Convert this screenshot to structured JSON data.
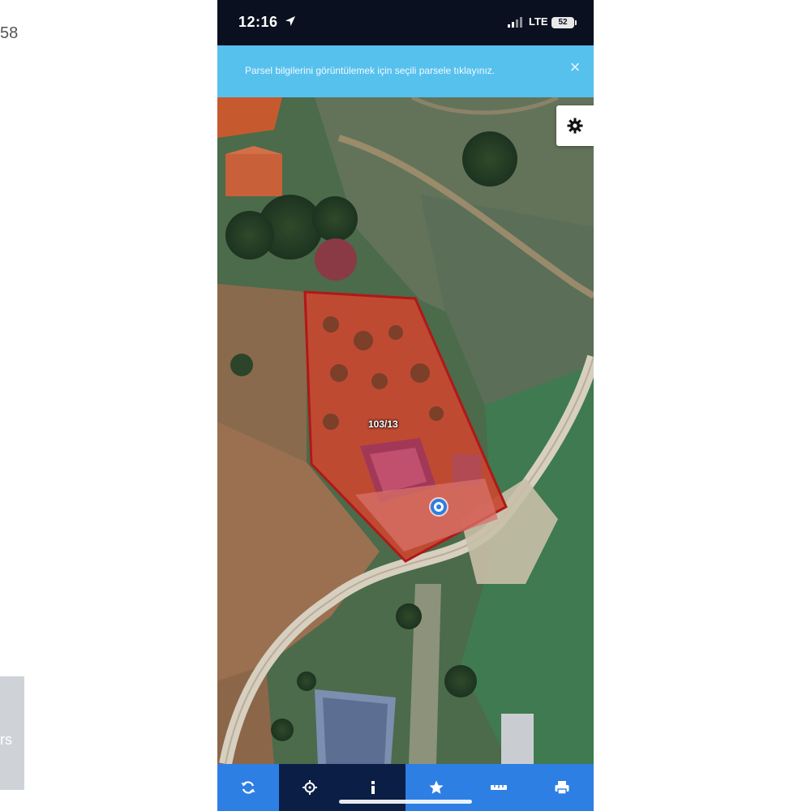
{
  "background": {
    "page_number": "58",
    "side_text": "rs"
  },
  "status_bar": {
    "time": "12:16",
    "network": "LTE",
    "battery": "52"
  },
  "banner": {
    "message": "Parsel bilgilerini görüntülemek için seçili parsele tıklayınız.",
    "close_icon": "close-icon"
  },
  "map": {
    "parcel_label": "103/13",
    "settings_icon": "gear-icon",
    "location_marker": "location-marker"
  },
  "toolbar": {
    "items": [
      {
        "icon": "refresh-icon",
        "label": "Refresh"
      },
      {
        "icon": "crosshair-icon",
        "label": "Locate"
      },
      {
        "icon": "info-icon",
        "label": "Info"
      },
      {
        "icon": "star-icon",
        "label": "Favorite"
      },
      {
        "icon": "ruler-icon",
        "label": "Measure"
      },
      {
        "icon": "printer-icon",
        "label": "Print"
      }
    ]
  },
  "colors": {
    "status_bar": "#0b1020",
    "banner": "#57c1ee",
    "toolbar_light": "#2e7fe4",
    "toolbar_dark": "#0b1e46",
    "parcel_border": "#b01818"
  }
}
